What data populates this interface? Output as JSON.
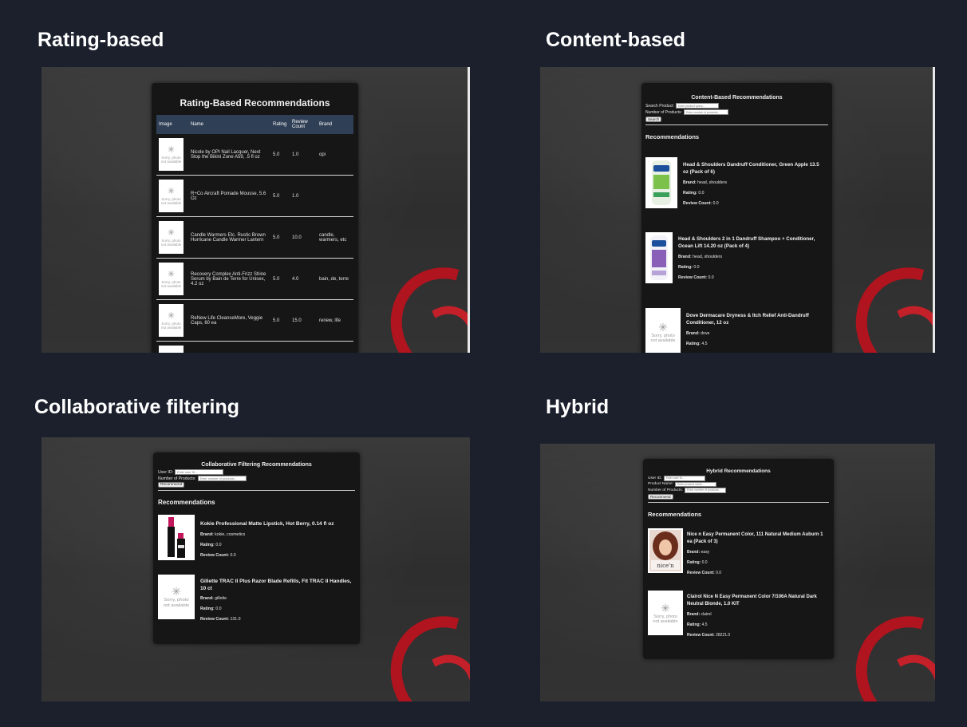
{
  "sections": {
    "rating": {
      "label": "Rating-based"
    },
    "content": {
      "label": "Content-based"
    },
    "collab": {
      "label": "Collaborative filtering"
    },
    "hybrid": {
      "label": "Hybrid"
    }
  },
  "placeholder": {
    "line1": "Sorry, photo",
    "line2": "not available"
  },
  "rating_app": {
    "title": "Rating-Based Recommendations",
    "columns": {
      "image": "Image",
      "name": "Name",
      "rating": "Rating",
      "review_count": "Review Count",
      "brand": "Brand"
    },
    "rows": [
      {
        "name": "Nicole by OPI Nail Lacquer, Next Stop the Bikini Zone A59, .5 fl oz",
        "rating": "5.0",
        "review_count": "1.0",
        "brand": "opi"
      },
      {
        "name": "R+Co Aircraft Pomade Mousse, 5.6 Oz",
        "rating": "5.0",
        "review_count": "1.0",
        "brand": ""
      },
      {
        "name": "Candle Warmers Etc. Rustic Brown Hurricane Candle Warmer Lantern",
        "rating": "5.0",
        "review_count": "10.0",
        "brand": "candle, warmers, etc"
      },
      {
        "name": "Recovery Complex Anti-Frizz Shine Serum by Bain de Terre for Unisex, 4.2 oz",
        "rating": "5.0",
        "review_count": "4.0",
        "brand": "bain, de, terre"
      },
      {
        "name": "ReNew Life CleanseMore, Veggie Caps, 60 ea",
        "rating": "5.0",
        "review_count": "15.0",
        "brand": "renew, life"
      }
    ]
  },
  "content_app": {
    "title": "Content-Based Recommendations",
    "search_label": "Search Product:",
    "search_placeholder": "Enter product query...",
    "count_label": "Number of Products:",
    "count_placeholder": "Enter number of products...",
    "button": "Search",
    "rec_heading": "Recommendations",
    "items": [
      {
        "name": "Head & Shoulders Dandruff Conditioner, Green Apple 13.5 oz (Pack of 6)",
        "brand": "head, shoulders",
        "rating": "0.0",
        "review_count": "0.0"
      },
      {
        "name": "Head & Shoulders 2 in 1 Dandruff Shampoo + Conditioner, Ocean Lift 14.20 oz (Pack of 4)",
        "brand": "head, shoulders",
        "rating": "0.0",
        "review_count": "0.0"
      },
      {
        "name": "Dove Dermacare Dryness & Itch Relief Anti-Dandruff Conditioner, 12 oz",
        "brand": "dove",
        "rating": "4.5"
      }
    ]
  },
  "collab_app": {
    "title": "Collaborative Filtering Recommendations",
    "user_label": "User ID:",
    "user_placeholder": "Enter user ID...",
    "count_label": "Number of Products:",
    "count_placeholder": "Enter number of products...",
    "button": "Recommend",
    "rec_heading": "Recommendations",
    "items": [
      {
        "name": "Kokie Professional Matte Lipstick, Hot Berry, 0.14 fl oz",
        "brand": "kokie, cosmetics",
        "rating": "0.0",
        "review_count": "0.0"
      },
      {
        "name": "Gillette TRAC II Plus Razor Blade Refills, Fit TRAC II Handles, 10 ct",
        "brand": "gillette",
        "rating": "0.0",
        "review_count": "131.0"
      }
    ]
  },
  "hybrid_app": {
    "title": "Hybrid Recommendations",
    "user_label": "User ID:",
    "user_placeholder": "Enter user ID...",
    "product_label": "Product Name:",
    "product_placeholder": "Enter product name...",
    "count_label": "Number of Products:",
    "count_placeholder": "Enter number of products...",
    "button": "Recommend",
    "rec_heading": "Recommendations",
    "items": [
      {
        "name": "Nice n Easy Permanent Color, 111 Natural Medium Auburn 1 ea (Pack of 3)",
        "brand": "easy",
        "rating": "0.0",
        "review_count": "0.0"
      },
      {
        "name": "Clairol Nice N Easy Permanent Color 7/106A Natural Dark Neutral Blonde, 1.0 KIT",
        "brand": "clairol",
        "rating": "4.5",
        "review_count": "28221.0"
      }
    ]
  },
  "labels": {
    "brand": "Brand:",
    "rating": "Rating:",
    "review_count": "Review Count:"
  },
  "colors": {
    "page_bg": "#1b202c",
    "card_bg": "#161616",
    "table_header": "#2f3f55",
    "ribbon": "#b0141e"
  },
  "logo_text": {
    "hs": "head& shoulders",
    "nice": "nice'n easy"
  }
}
